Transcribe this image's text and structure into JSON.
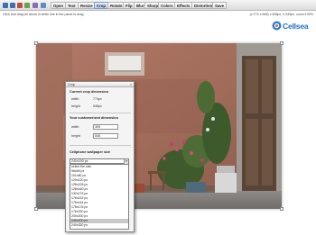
{
  "toolbar": {
    "tools": [
      {
        "icon": "pencil-icon",
        "color": "#3b6fb6"
      },
      {
        "icon": "line-icon",
        "color": "#3b6fb6"
      },
      {
        "icon": "brush-icon",
        "color": "#c44b3a"
      },
      {
        "icon": "eraser-icon",
        "color": "#6aa24a"
      },
      {
        "icon": "eyedropper-icon",
        "color": "#8a6bb5"
      },
      {
        "icon": "zoom-icon",
        "color": "#5f8fc0"
      }
    ],
    "buttons": [
      "Open",
      "Text",
      "Resize",
      "Crop",
      "Rotate",
      "Flip",
      "Blur",
      "Sharp",
      "Colors",
      "Effects",
      "Distortion",
      "Save"
    ],
    "active": "Crop"
  },
  "status": {
    "hint": "Click and drag an arrow in white line in the panel to drag",
    "dims": "(x:774 x:548) x 606px, h 545px, zoom:100%"
  },
  "logo": {
    "text": "Cellsea",
    "color": "#1f6fc0"
  },
  "crop_dialog": {
    "title": "Crop",
    "close": "×",
    "current_title": "Current crop dimension",
    "width_label": "width",
    "width_value": "774px",
    "height_label": "height",
    "height_value": "548px",
    "custom_title": "Your customerized dimension",
    "custom_width_label": "width",
    "custom_width_value": "309",
    "custom_height_label": "height",
    "custom_height_value": "545",
    "wallpaper_title": "Cellphone wallpaper size",
    "wallpaper_selected": "240x200 px",
    "wallpaper_options": [
      "select the size",
      "96x65 px",
      "101x80 px",
      "120x120 px",
      "128x128 px",
      "128x160 px",
      "132x176 px",
      "176x132 px",
      "176x144 px",
      "176x176 px",
      "176x220 px",
      "200x200 px",
      "240x200 px",
      "240x320 px"
    ],
    "wallpaper_highlighted": "240x200 px"
  }
}
